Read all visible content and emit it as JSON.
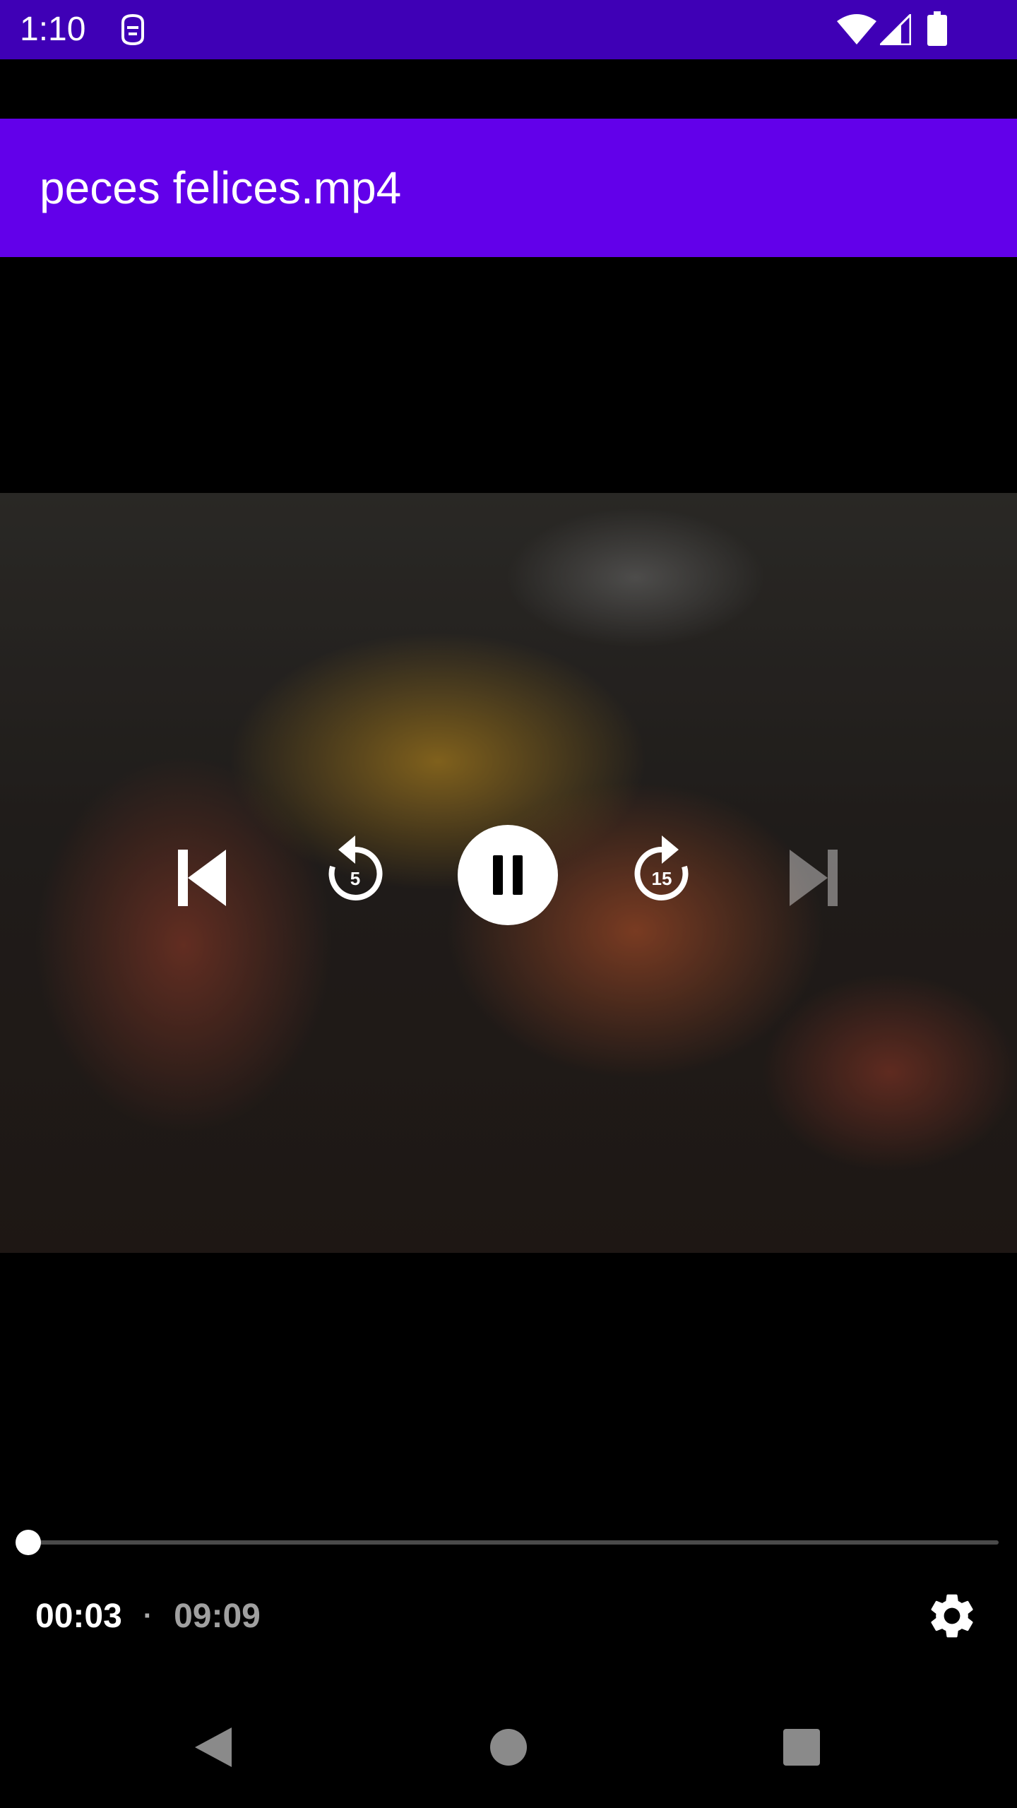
{
  "status_bar": {
    "time": "1:10",
    "background": "#3f00b6",
    "icons": [
      "sim-notification-icon",
      "wifi-icon",
      "cellular-signal-icon",
      "battery-icon"
    ]
  },
  "app_bar": {
    "title": "peces felices.mp4",
    "background": "#6200ea"
  },
  "player": {
    "controls": {
      "previous": "skip-previous-icon",
      "rewind": {
        "icon": "replay-icon",
        "label": "5"
      },
      "play_pause": "pause-icon",
      "forward": {
        "icon": "forward-icon",
        "label": "15"
      },
      "next": "skip-next-icon"
    },
    "next_enabled": false,
    "progress_fraction": 0.0055,
    "current_time": "00:03",
    "separator": "·",
    "total_time": "09:09",
    "settings_icon": "gear-icon"
  },
  "nav_bar": {
    "buttons": [
      "back-icon",
      "home-icon",
      "recents-icon"
    ]
  }
}
